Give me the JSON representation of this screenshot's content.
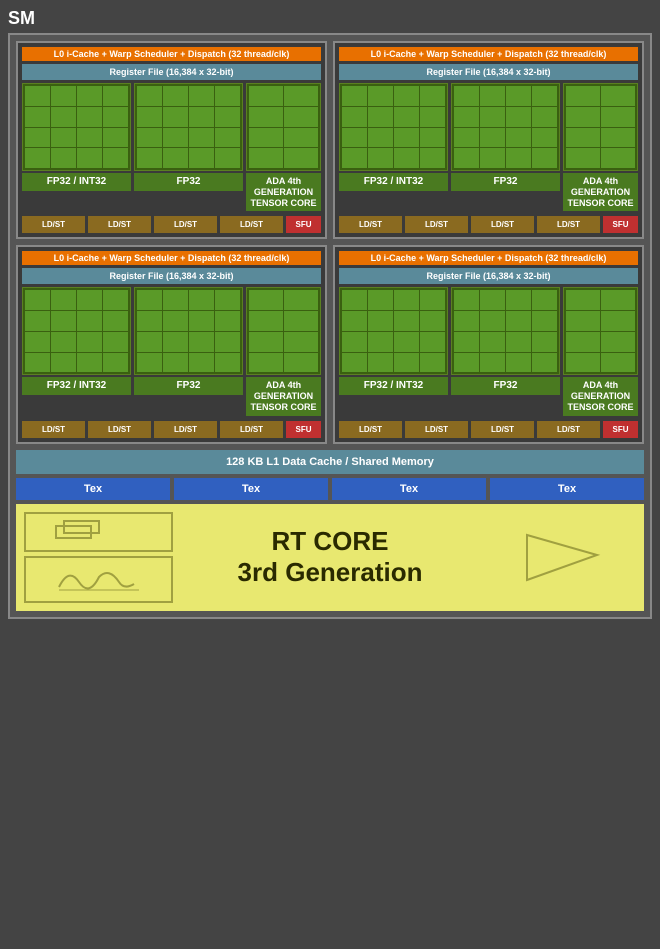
{
  "sm_label": "SM",
  "l0_bar": "L0 i-Cache + Warp Scheduler + Dispatch (32 thread/clk)",
  "reg_file": "Register File (16,384 x 32-bit)",
  "fp32_int32": "FP32 / INT32",
  "fp32": "FP32",
  "tensor_core": "ADA 4th GENERATION TENSOR CORE",
  "ldst": "LD/ST",
  "sfu": "SFU",
  "l1_cache": "128 KB L1 Data Cache / Shared Memory",
  "tex": "Tex",
  "rt_core_title": "RT CORE",
  "rt_core_sub": "3rd Generation",
  "colors": {
    "orange": "#e87000",
    "teal": "#5a8a9a",
    "green_dark": "#3a6010",
    "green_mid": "#4a7a20",
    "green_light": "#5a9a28",
    "brown": "#8a6a20",
    "red": "#c03030",
    "blue": "#3060c0",
    "yellow_bg": "#e8e870",
    "bg_outer": "#555555",
    "bg_inner": "#3a3a3a"
  }
}
